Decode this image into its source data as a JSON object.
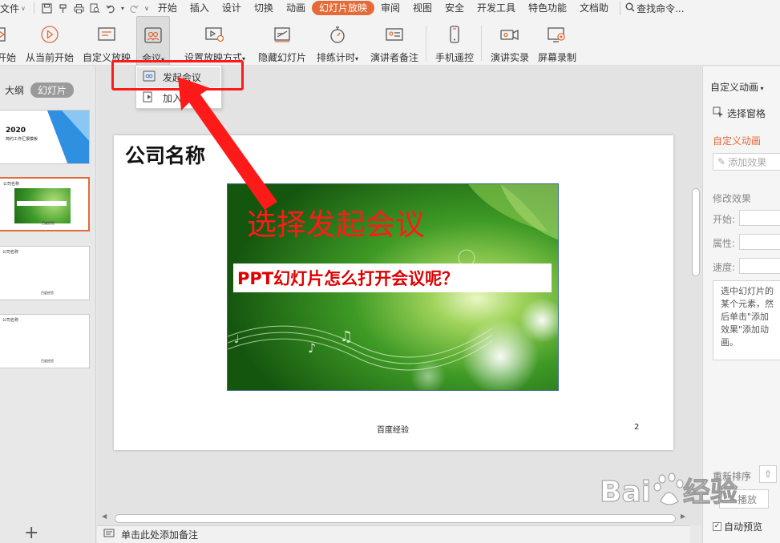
{
  "menubar": {
    "file_label": "文件",
    "tabs": [
      "开始",
      "插入",
      "设计",
      "切换",
      "动画",
      "幻灯片放映",
      "审阅",
      "视图",
      "安全",
      "开发工具",
      "特色功能",
      "文档助"
    ],
    "active_tab": "幻灯片放映",
    "search_placeholder": "查找命令..."
  },
  "ribbon": {
    "buttons": [
      {
        "label": "开始"
      },
      {
        "label": "从当前开始"
      },
      {
        "label": "自定义放映"
      },
      {
        "label": "会议"
      },
      {
        "label": "设置放映方式"
      },
      {
        "label": "隐藏幻灯片"
      },
      {
        "label": "排练计时"
      },
      {
        "label": "演讲者备注"
      },
      {
        "label": "手机遥控"
      },
      {
        "label": "演讲实录"
      },
      {
        "label": "屏幕录制"
      }
    ]
  },
  "dropdown": {
    "items": [
      {
        "label": "发起会议"
      },
      {
        "label": "加入会议"
      }
    ]
  },
  "left_panel": {
    "tab_outline": "大纲",
    "tab_slides": "幻灯片",
    "thumb1": {
      "year": "2020",
      "line": "简约工作汇报模板"
    },
    "thumb_title": "公司名称"
  },
  "slide": {
    "title": "公司名称",
    "annotation": "选择发起会议",
    "caption": "PPT幻灯片怎么打开会议呢？",
    "footer": "百度经验",
    "number": "2"
  },
  "notes_placeholder": "单击此处添加备注",
  "right_pane": {
    "title": "自定义动画",
    "select_pane": "选择窗格",
    "custom_anim": "自定义动画",
    "add_effect": "添加效果",
    "modify_effect": "修改效果",
    "start": "开始:",
    "property": "属性:",
    "speed": "速度:",
    "description": "选中幻灯片的某个元素，然后单击\"添加效果\"添加动画。",
    "reorder": "重新排序",
    "play": "播放",
    "auto_preview": "自动预览"
  },
  "watermark": {
    "brand": "Baidu经验",
    "url": "jingyan.baidu.com"
  }
}
